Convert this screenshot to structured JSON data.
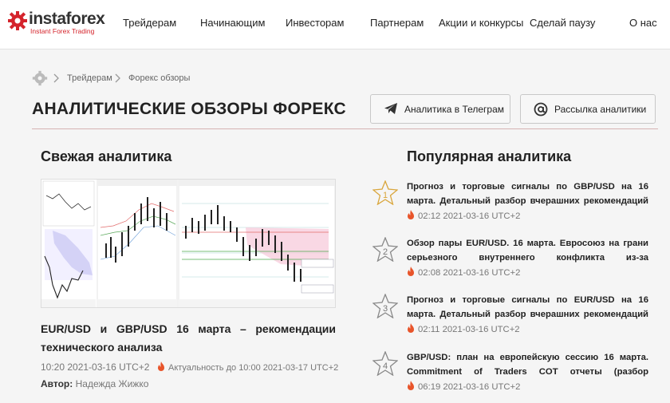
{
  "header": {
    "logo_text": "instaforex",
    "logo_sub": "Instant Forex Trading",
    "nav": [
      "Трейдерам",
      "Начинающим",
      "Инвесторам",
      "Партнерам",
      "Акции и конкурсы",
      "Сделай паузу",
      "О нас"
    ]
  },
  "breadcrumb": [
    "Трейдерам",
    "Форекс обзоры"
  ],
  "page_title": "АНАЛИТИЧЕСКИЕ ОБЗОРЫ ФОРЕКС",
  "buttons": {
    "telegram": "Аналитика в Телеграм",
    "mailing": "Рассылка аналитики"
  },
  "fresh": {
    "heading": "Свежая аналитика",
    "article_title": "EUR/USD и GBP/USD 16 марта – рекомендации технического анализа",
    "date": "10:20 2021-03-16 UTC+2",
    "relevance": "Актуальность до 10:00 2021-03-17 UTC+2",
    "author_label": "Автор:",
    "author": "Надежда Жижко"
  },
  "popular": {
    "heading": "Популярная аналитика",
    "items": [
      {
        "rank": "1",
        "title": "Прогноз и торговые сигналы по GBP/USD на 16 марта. Детальный разбор вчерашних рекомендаций и",
        "date": "02:12 2021-03-16 UTC+2"
      },
      {
        "rank": "2",
        "title": "Обзор пары EUR/USD. 16 марта. Евросоюз на грани серьезного внутреннего конфликта из-за вакцинации.",
        "date": "02:08 2021-03-16 UTC+2"
      },
      {
        "rank": "3",
        "title": "Прогноз и торговые сигналы по EUR/USD на 16 марта. Детальный разбор вчерашних рекомендаций и",
        "date": "02:11 2021-03-16 UTC+2"
      },
      {
        "rank": "4",
        "title": "GBP/USD: план на европейскую сессию 16 марта. Commitment of Traders COT отчеты (разбор вчерашних",
        "date": "06:19 2021-03-16 UTC+2"
      }
    ]
  },
  "colors": {
    "brand_red": "#d4232b",
    "gold_star": "#d9a63c",
    "flame": "#e8542a"
  }
}
